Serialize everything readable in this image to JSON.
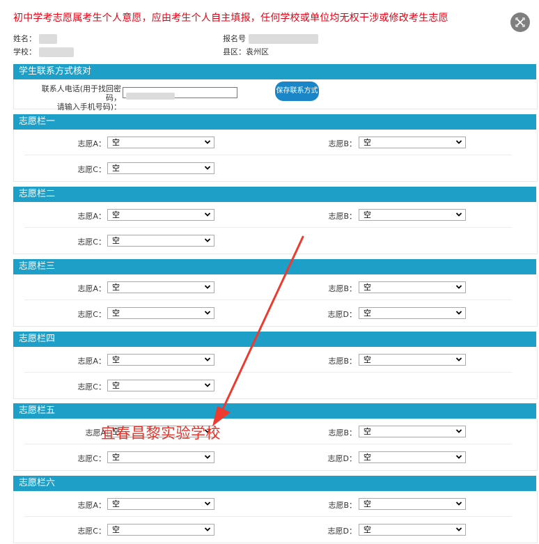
{
  "notice": "初中学考志愿属考生个人意愿，应由考生个人自主填报，任何学校或单位均无权干涉或修改考生志愿",
  "info": {
    "name_label": "姓名：",
    "school_label": "学校：",
    "regno_label": "报名号",
    "county_label": "县区：",
    "county_value": "袁州区"
  },
  "contact": {
    "title": "学生联系方式核对",
    "phone_label_line1": "联系人电话(用于找回密码，",
    "phone_label_line2": "请输入手机号码)：",
    "save_label": "保存联系方式"
  },
  "sections": [
    {
      "title": "志愿栏一",
      "rows": [
        [
          {
            "label": "志愿A：",
            "value": "空"
          },
          {
            "label": "志愿B：",
            "value": "空"
          }
        ],
        [
          {
            "label": "志愿C：",
            "value": "空"
          }
        ]
      ]
    },
    {
      "title": "志愿栏二",
      "rows": [
        [
          {
            "label": "志愿A：",
            "value": "空"
          },
          {
            "label": "志愿B：",
            "value": "空"
          }
        ],
        [
          {
            "label": "志愿C：",
            "value": "空"
          }
        ]
      ]
    },
    {
      "title": "志愿栏三",
      "rows": [
        [
          {
            "label": "志愿A：",
            "value": "空"
          },
          {
            "label": "志愿B：",
            "value": "空"
          }
        ],
        [
          {
            "label": "志愿C：",
            "value": "空"
          },
          {
            "label": "志愿D：",
            "value": "空"
          }
        ]
      ]
    },
    {
      "title": "志愿栏四",
      "rows": [
        [
          {
            "label": "志愿A：",
            "value": "空"
          },
          {
            "label": "志愿B：",
            "value": "空"
          }
        ],
        [
          {
            "label": "志愿C：",
            "value": "空"
          }
        ]
      ]
    },
    {
      "title": "志愿栏五",
      "rows": [
        [
          {
            "label": "志愿A",
            "value": "空"
          },
          {
            "label": "志愿B：",
            "value": "空"
          }
        ],
        [
          {
            "label": "志愿C：",
            "value": "空"
          },
          {
            "label": "志愿D：",
            "value": "空"
          }
        ]
      ]
    },
    {
      "title": "志愿栏六",
      "rows": [
        [
          {
            "label": "志愿A：",
            "value": "空"
          },
          {
            "label": "志愿B：",
            "value": "空"
          }
        ],
        [
          {
            "label": "志愿C：",
            "value": "空"
          },
          {
            "label": "志愿D：",
            "value": "空"
          }
        ]
      ]
    }
  ],
  "annotation": "宜春昌黎实验学校",
  "colors": {
    "header": "#1e9fc7",
    "notice": "#e60012",
    "annotation": "#e8332a",
    "button": "#1a86c8"
  }
}
